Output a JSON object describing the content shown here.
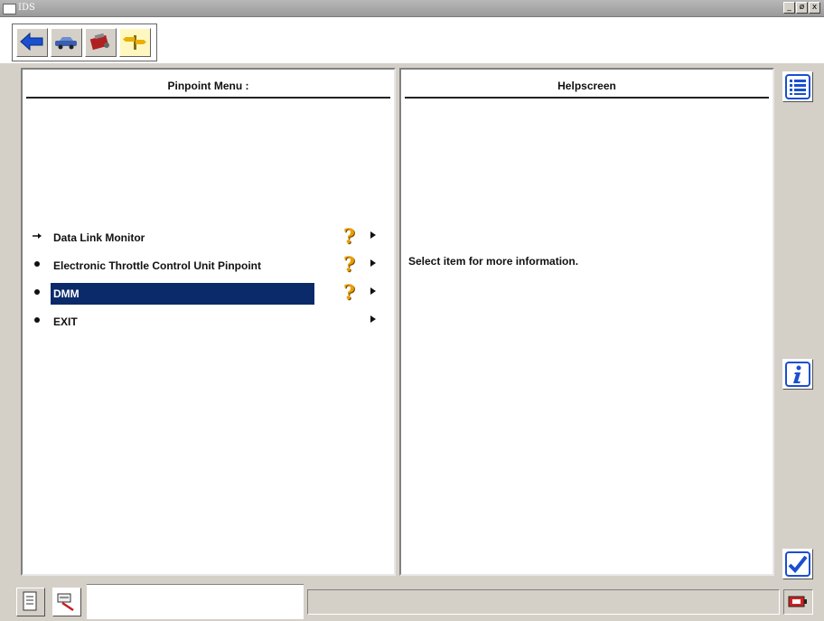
{
  "window": {
    "title": "IDS",
    "minimize": "_",
    "maximize": "ø",
    "close": "x"
  },
  "toolbar": {
    "icons": [
      "back-arrow-icon",
      "vehicle-icon",
      "engine-icon",
      "signpost-icon"
    ]
  },
  "left_panel": {
    "title": "Pinpoint Menu :",
    "items": [
      {
        "label": "Data Link Monitor",
        "bullet": "arrow",
        "has_help": true,
        "help_glyph": "?"
      },
      {
        "label": "Electronic Throttle Control Unit Pinpoint",
        "bullet": "dot",
        "has_help": true,
        "help_glyph": "?"
      },
      {
        "label": "DMM",
        "bullet": "dot",
        "has_help": true,
        "help_glyph": "?",
        "selected": true
      },
      {
        "label": "EXIT",
        "bullet": "dot",
        "has_help": false
      }
    ]
  },
  "right_panel": {
    "title": "Helpscreen",
    "message": "Select item for more information."
  },
  "side_buttons": [
    "list-icon",
    "info-icon",
    "checkmark-icon"
  ],
  "bottom": {
    "tabs": [
      "document-icon",
      "tools-icon"
    ],
    "status_text": "",
    "battery_icon": "battery-icon"
  },
  "colors": {
    "selection": "#0a2a6a",
    "help_icon": "#e8a000",
    "accent_blue": "#1a4fd0"
  }
}
